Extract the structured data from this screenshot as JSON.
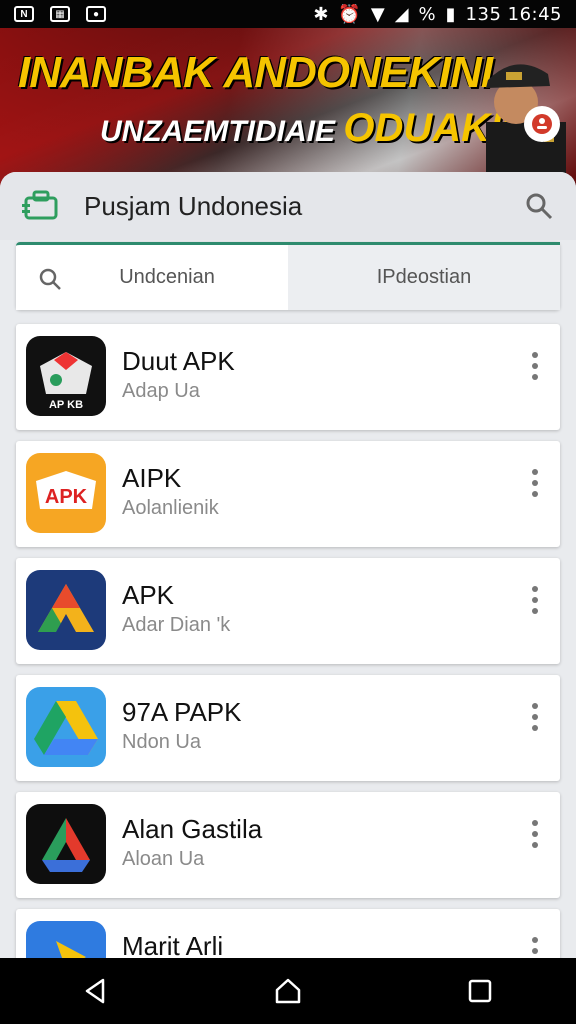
{
  "status_bar": {
    "left_icons": [
      "n-notification-icon",
      "image-notification-icon",
      "chat-notification-icon"
    ],
    "right_text": "135 16:45",
    "battery_text": "%"
  },
  "banner": {
    "title": "INANBAK ANDONEKINI",
    "subtitle_main": "UNZAEMTIDIAIE",
    "subtitle_accent": "ODUAKK"
  },
  "header": {
    "title": "Pusjam Undonesia"
  },
  "tabs": [
    {
      "label": "Undcenian"
    },
    {
      "label": "IPdeostian"
    }
  ],
  "apps": [
    {
      "name": "Duut APK",
      "subtitle": "Adap Ua",
      "icon": "apk-maps-icon"
    },
    {
      "name": "AIPK",
      "subtitle": "Aolanlienik",
      "icon": "apk-orange-icon"
    },
    {
      "name": "APK",
      "subtitle": "Adar Dian 'k",
      "icon": "apk-triangle-icon"
    },
    {
      "name": "97A PAPK",
      "subtitle": "Ndon Ua",
      "icon": "drive-icon"
    },
    {
      "name": "Alan Gastila",
      "subtitle": "Aloan Ua",
      "icon": "drive-dark-icon"
    },
    {
      "name": "Marit Arli",
      "subtitle": "",
      "icon": "blue-yellow-icon"
    }
  ],
  "colors": {
    "accent": "#2e8b6e",
    "banner_yellow": "#f5c400"
  }
}
